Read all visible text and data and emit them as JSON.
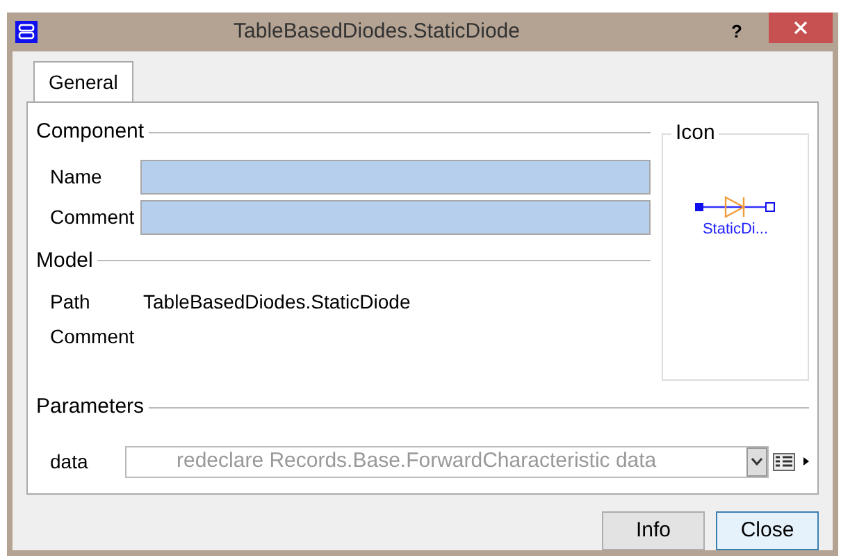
{
  "window": {
    "title": "TableBasedDiodes.StaticDiode",
    "help": "?"
  },
  "tabs": [
    {
      "label": "General",
      "selected": true
    }
  ],
  "component": {
    "heading": "Component",
    "fields": [
      {
        "label": "Name"
      },
      {
        "label": "Comment"
      }
    ]
  },
  "icon_box": {
    "heading": "Icon",
    "caption": "StaticDi..."
  },
  "model": {
    "heading": "Model",
    "rows": [
      {
        "label": "Path",
        "value": "TableBasedDiodes.StaticDiode"
      },
      {
        "label": "Comment"
      }
    ]
  },
  "parameters": {
    "heading": "Parameters",
    "rows": [
      {
        "label": "data",
        "value": "redeclare Records.Base.ForwardCharacteristic data",
        "disabled": true
      }
    ]
  },
  "buttons": [
    {
      "label": "Info",
      "default": false
    },
    {
      "label": "Close",
      "default": true
    }
  ]
}
